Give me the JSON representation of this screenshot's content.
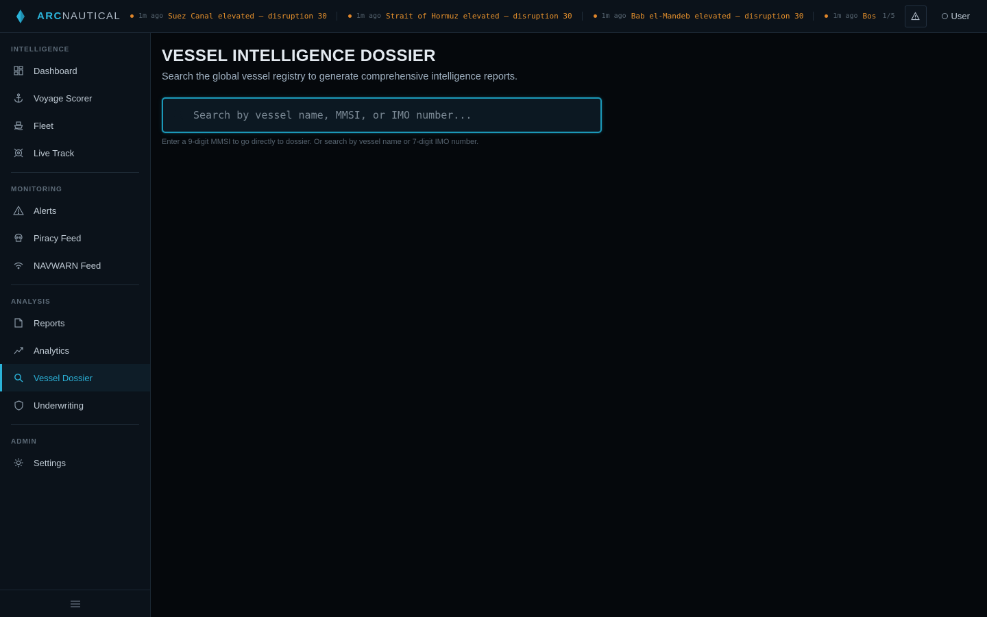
{
  "brand": {
    "arc": "ARC",
    "nautical": "NAUTICAL"
  },
  "ticker": {
    "items": [
      {
        "time": "1m ago",
        "text": "Suez Canal elevated — disruption 30"
      },
      {
        "time": "1m ago",
        "text": "Strait of Hormuz elevated — disruption 30"
      },
      {
        "time": "1m ago",
        "text": "Bab el-Mandeb elevated — disruption 30"
      },
      {
        "time": "1m ago",
        "text": "Bosp"
      }
    ],
    "count": "1/5"
  },
  "user": {
    "label": "User"
  },
  "sidebar": {
    "intelligence": {
      "label": "INTELLIGENCE",
      "items": [
        {
          "label": "Dashboard",
          "icon": "grid-icon"
        },
        {
          "label": "Voyage Scorer",
          "icon": "anchor-icon"
        },
        {
          "label": "Fleet",
          "icon": "ship-icon"
        },
        {
          "label": "Live Track",
          "icon": "crosshair-icon"
        }
      ]
    },
    "monitoring": {
      "label": "MONITORING",
      "items": [
        {
          "label": "Alerts",
          "icon": "warning-icon"
        },
        {
          "label": "Piracy Feed",
          "icon": "skull-icon"
        },
        {
          "label": "NAVWARN Feed",
          "icon": "wifi-icon"
        }
      ]
    },
    "analysis": {
      "label": "ANALYSIS",
      "items": [
        {
          "label": "Reports",
          "icon": "file-icon"
        },
        {
          "label": "Analytics",
          "icon": "trend-icon"
        },
        {
          "label": "Vessel Dossier",
          "icon": "search-icon",
          "active": true
        },
        {
          "label": "Underwriting",
          "icon": "shield-icon"
        }
      ]
    },
    "admin": {
      "label": "ADMIN",
      "items": [
        {
          "label": "Settings",
          "icon": "gear-icon"
        }
      ]
    }
  },
  "main": {
    "title": "VESSEL INTELLIGENCE DOSSIER",
    "subtitle": "Search the global vessel registry to generate comprehensive intelligence reports.",
    "search_placeholder": "Search by vessel name, MMSI, or IMO number...",
    "helper": "Enter a 9-digit MMSI to go directly to dossier. Or search by vessel name or 7-digit IMO number."
  },
  "colors": {
    "accent": "#2bb3d9",
    "warning": "#e38f2c",
    "background": "#05080c"
  }
}
